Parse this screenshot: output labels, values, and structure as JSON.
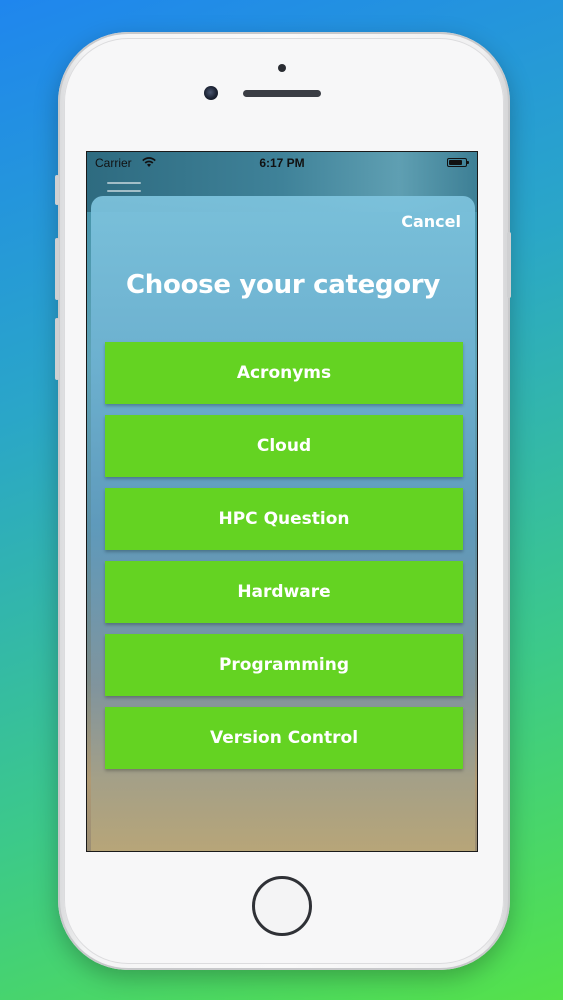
{
  "status_bar": {
    "carrier": "Carrier",
    "time": "6:17 PM",
    "icons": [
      "wifi-icon",
      "battery-icon"
    ]
  },
  "modal": {
    "cancel_label": "Cancel",
    "title": "Choose your category",
    "categories": [
      {
        "label": "Acronyms"
      },
      {
        "label": "Cloud"
      },
      {
        "label": "HPC Question"
      },
      {
        "label": "Hardware"
      },
      {
        "label": "Programming"
      },
      {
        "label": "Version Control"
      }
    ]
  },
  "colors": {
    "button_green": "#64d322",
    "text_white": "#ffffff",
    "background_gradient_start": "#1f86ee",
    "background_gradient_end": "#55e24a"
  }
}
